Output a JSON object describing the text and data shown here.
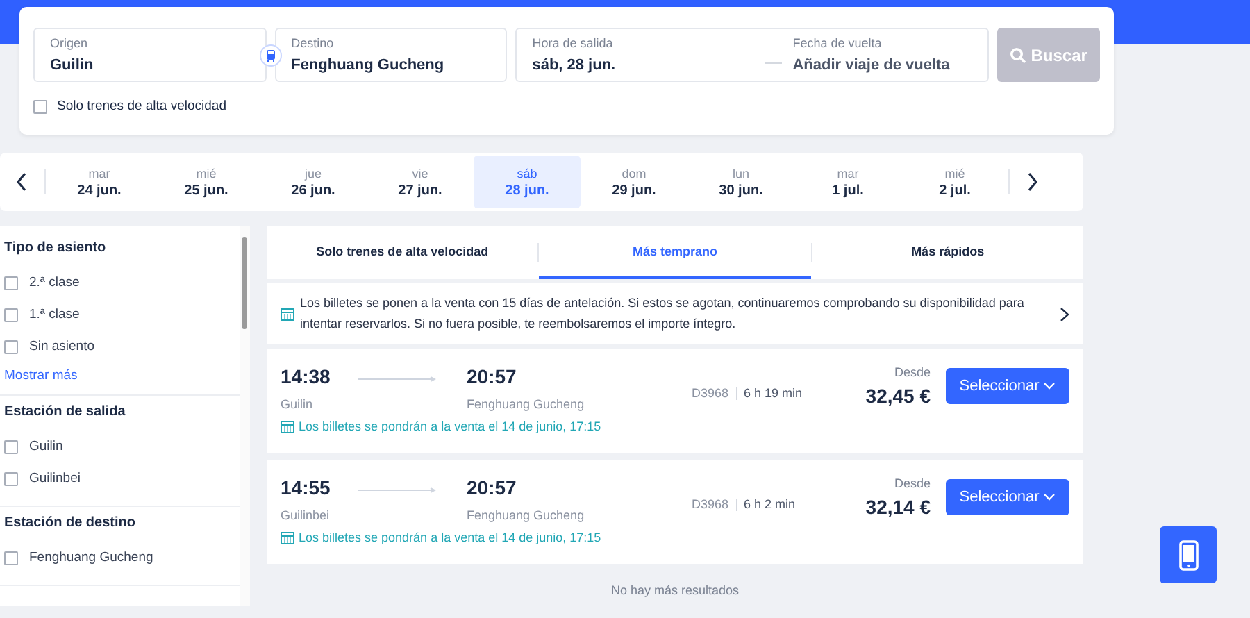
{
  "search": {
    "fields": [
      {
        "label": "Origen",
        "value": "Guilin"
      },
      {
        "label": "Destino",
        "value": "Fenghuang Gucheng"
      }
    ],
    "departure": {
      "label": "Hora de salida",
      "value": "sáb, 28 jun."
    },
    "return": {
      "label": "Fecha de vuelta",
      "placeholder": "Añadir viaje de vuelta"
    },
    "button": "Buscar",
    "button_disabled": true,
    "high_speed": {
      "label": "Solo trenes de alta velocidad",
      "checked": false
    }
  },
  "dates": [
    {
      "day": "mar",
      "date": "24 jun.",
      "selected": false
    },
    {
      "day": "mié",
      "date": "25 jun.",
      "selected": false
    },
    {
      "day": "jue",
      "date": "26 jun.",
      "selected": false
    },
    {
      "day": "vie",
      "date": "27 jun.",
      "selected": false
    },
    {
      "day": "sáb",
      "date": "28 jun.",
      "selected": true
    },
    {
      "day": "dom",
      "date": "29 jun.",
      "selected": false
    },
    {
      "day": "lun",
      "date": "30 jun.",
      "selected": false
    },
    {
      "day": "mar",
      "date": "1 jul.",
      "selected": false
    },
    {
      "day": "mié",
      "date": "2 jul.",
      "selected": false
    }
  ],
  "filters": [
    {
      "title": "Tipo de asiento",
      "options": [
        {
          "label": "2.ª clase",
          "checked": false
        },
        {
          "label": "1.ª clase",
          "checked": false
        },
        {
          "label": "Sin asiento",
          "checked": false
        }
      ],
      "more": "Mostrar más"
    },
    {
      "title": "Estación de salida",
      "options": [
        {
          "label": "Guilin",
          "checked": false
        },
        {
          "label": "Guilinbei",
          "checked": false
        }
      ]
    },
    {
      "title": "Estación de destino",
      "options": [
        {
          "label": "Fenghuang Gucheng",
          "checked": false
        }
      ]
    }
  ],
  "tabs": [
    {
      "label": "Solo trenes de alta velocidad",
      "selected": false
    },
    {
      "label": "Más temprano",
      "selected": true
    },
    {
      "label": "Más rápidos",
      "selected": false
    }
  ],
  "notice": "Los billetes se ponen a la venta con 15 días de antelación. Si estos se agotan, continuaremos comprobando su disponibilidad para intentar reservarlos. Si no fuera posible, te reembolsaremos el importe íntegro.",
  "trains": [
    {
      "depart": "14:38",
      "from": "Guilin",
      "arrive": "20:57",
      "to": "Fenghuang Gucheng",
      "number": "D3968",
      "duration": "6 h 19 min",
      "price_label": "Desde",
      "price": "32,45 €",
      "sale_note": "Los billetes se pondrán a la venta el 14 de junio, 17:15",
      "button": "Seleccionar"
    },
    {
      "depart": "14:55",
      "from": "Guilinbei",
      "arrive": "20:57",
      "to": "Fenghuang Gucheng",
      "number": "D3968",
      "duration": "6 h 2 min",
      "price_label": "Desde",
      "price": "32,14 €",
      "sale_note": "Los billetes se pondrán a la venta el 14 de junio, 17:15",
      "button": "Seleccionar"
    }
  ],
  "footer": "No hay más resultados"
}
